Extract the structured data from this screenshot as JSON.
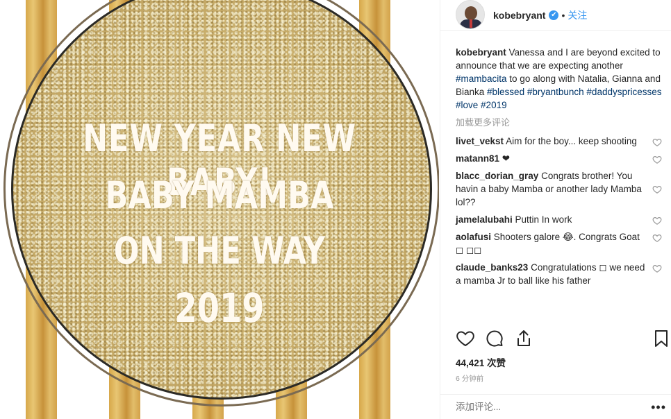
{
  "post_image": {
    "lines": [
      "NEW YEAR NEW BABY!",
      "BABY MAMBA",
      "ON THE WAY",
      "2019"
    ]
  },
  "header": {
    "username": "kobebryant",
    "verified_mark": "✔",
    "separator": "•",
    "follow_label": "关注"
  },
  "caption": {
    "user": "kobebryant",
    "text_1": " Vanessa and I are beyond excited to announce that we are expecting another ",
    "tag_1": "#mambacita",
    "text_2": " to go along with Natalia, Gianna and Bianka ",
    "tag_2": "#blessed",
    "tag_3": "#bryantbunch",
    "tag_4": "#daddyspricesses",
    "tag_5": "#love",
    "tag_6": "#2019"
  },
  "load_more_label": "加载更多评论",
  "comments": [
    {
      "user": "livet_vekst",
      "text": " Aim for the boy... keep shooting"
    },
    {
      "user": "matann81",
      "text": " ❤"
    },
    {
      "user": "blacc_dorian_gray",
      "text": " Congrats brother! You havin a baby Mamba or another lady Mamba lol??"
    },
    {
      "user": "jamelalubahi",
      "text": " Puttin In work"
    },
    {
      "user": "aolafusi",
      "text": " Shooters galore 😂. Congrats Goat ◻ ◻◻"
    },
    {
      "user": "claude_banks23",
      "text": " Congratulations ◻ we need a mamba Jr to ball like his father"
    }
  ],
  "likes_label": "44,421 次赞",
  "time_label": "6 分钟前",
  "add_comment_placeholder": "添加评论...",
  "more_label": "•••",
  "icons": {
    "like": "heart-icon",
    "comment": "comment-icon",
    "share": "share-icon",
    "save": "bookmark-icon",
    "comment_like": "heart-icon"
  },
  "colors": {
    "accent": "#3897f0",
    "hashtag": "#003569",
    "muted": "#999999",
    "gold": "#d7a84a"
  }
}
